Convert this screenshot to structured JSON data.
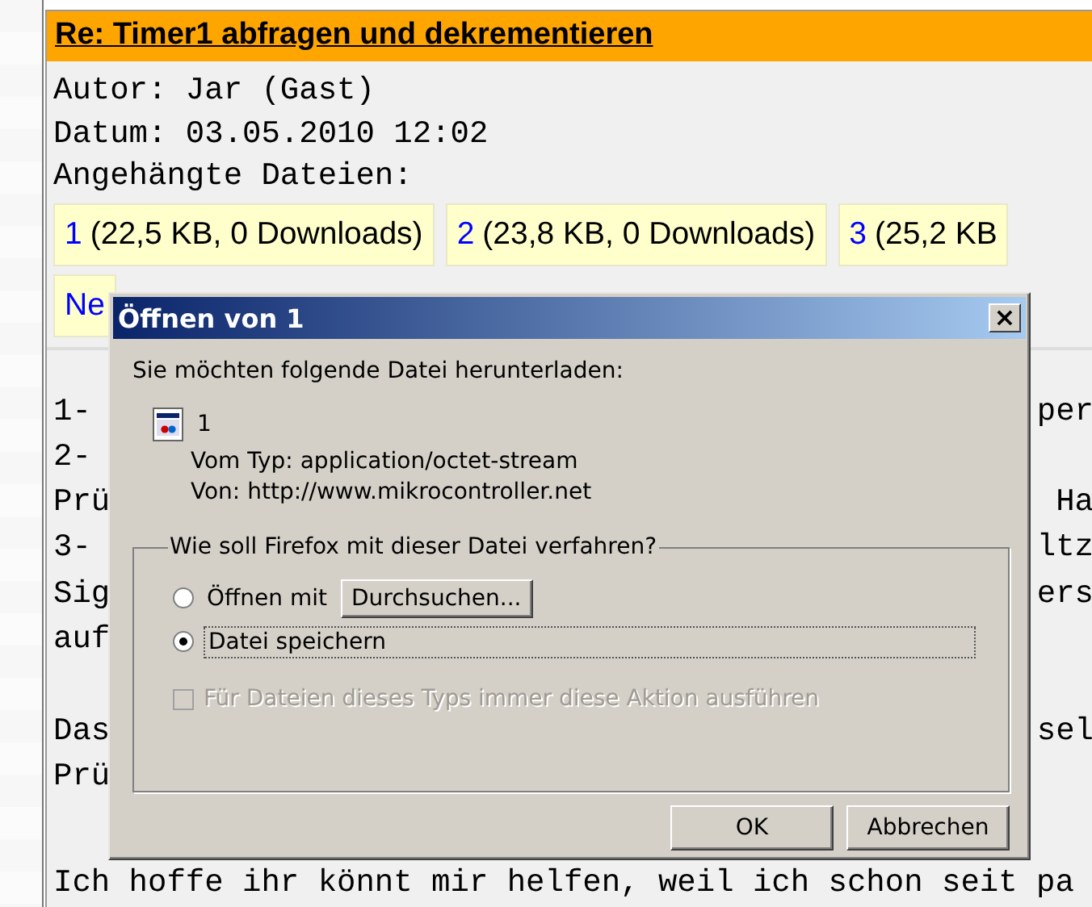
{
  "post": {
    "title": "Re: Timer1 abfragen und dekrementieren",
    "meta": [
      "Autor: Jar (Gast)",
      "Datum: 03.05.2010 12:02",
      "Angehängte Dateien:"
    ],
    "attachments": [
      {
        "link": "1",
        "info": "(22,5 KB, 0 Downloads)"
      },
      {
        "link": "2",
        "info": "(23,8 KB, 0 Downloads)"
      },
      {
        "link": "3",
        "info": "(25,2 KB"
      }
    ],
    "second_row_link": "Ne",
    "body_lines": [
      {
        "left": "1-",
        "right": "per"
      },
      {
        "left": "2-"
      },
      {
        "left": "Prü",
        "right": "Ha"
      },
      {
        "left": "3-",
        "right": "ltz"
      },
      {
        "left": "Sig",
        "right": "ers"
      },
      {
        "left": "auf"
      },
      {
        "left": "Das",
        "right": "sel",
        "gap_before": true
      },
      {
        "left": "Prü"
      },
      {
        "gap_before": true,
        "left": "Ich hoffe ihr könnt mir helfen, weil ich schon seit pa"
      }
    ]
  },
  "dialog": {
    "title": "Öffnen von 1",
    "close": "×",
    "intro": "Sie möchten folgende Datei herunterladen:",
    "file_name": "1",
    "type_line": "Vom Typ: application/octet-stream",
    "from_line": "Von: http://www.mikrocontroller.net",
    "group_label": "Wie soll Firefox mit dieser Datei verfahren?",
    "options": [
      {
        "label": "Öffnen mit",
        "selected": false,
        "kind": "browse"
      },
      {
        "label": "Datei speichern",
        "selected": true,
        "kind": "plain"
      }
    ],
    "browse_button": "Durchsuchen...",
    "always": {
      "label": "Für Dateien dieses Typs immer diese Aktion ausführen",
      "checked": false,
      "disabled": true
    },
    "buttons": [
      "OK",
      "Abbrechen"
    ]
  }
}
